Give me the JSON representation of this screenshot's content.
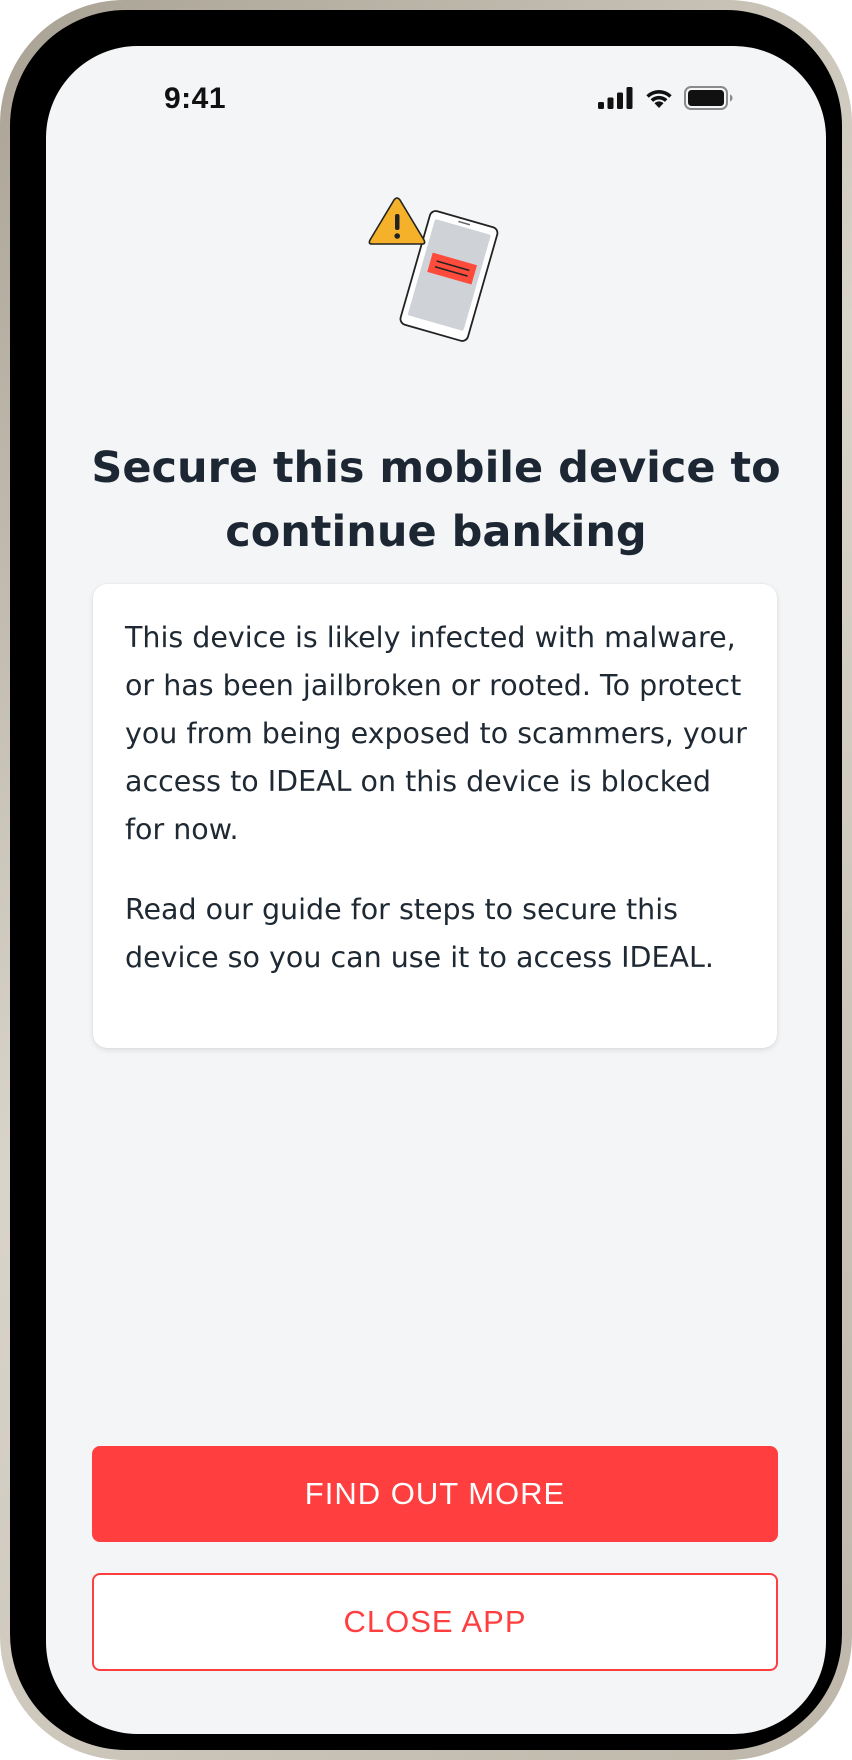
{
  "status_bar": {
    "time": "9:41",
    "icons": [
      "signal-icon",
      "wifi-icon",
      "battery-icon"
    ]
  },
  "illustration": {
    "icons": [
      "warning-icon",
      "phone-icon"
    ],
    "colors": {
      "warning": "#f6b12a",
      "alert_banner": "#fe4b3b",
      "screen": "#cfd3d8"
    }
  },
  "main": {
    "title": "Secure this mobile device to continue banking",
    "paragraphs": [
      "This device is likely infected with malware, or has been jailbroken or rooted. To protect you from being exposed to scammers, your access to IDEAL on this device is blocked for now.",
      "Read our guide for steps to secure this device so you can use it to access IDEAL."
    ]
  },
  "actions": {
    "find_out_more_label": "FIND OUT MORE",
    "close_app_label": "CLOSE APP"
  },
  "colors": {
    "accent": "#fe3e3f",
    "background": "#f4f5f7",
    "text": "#1c2733"
  }
}
